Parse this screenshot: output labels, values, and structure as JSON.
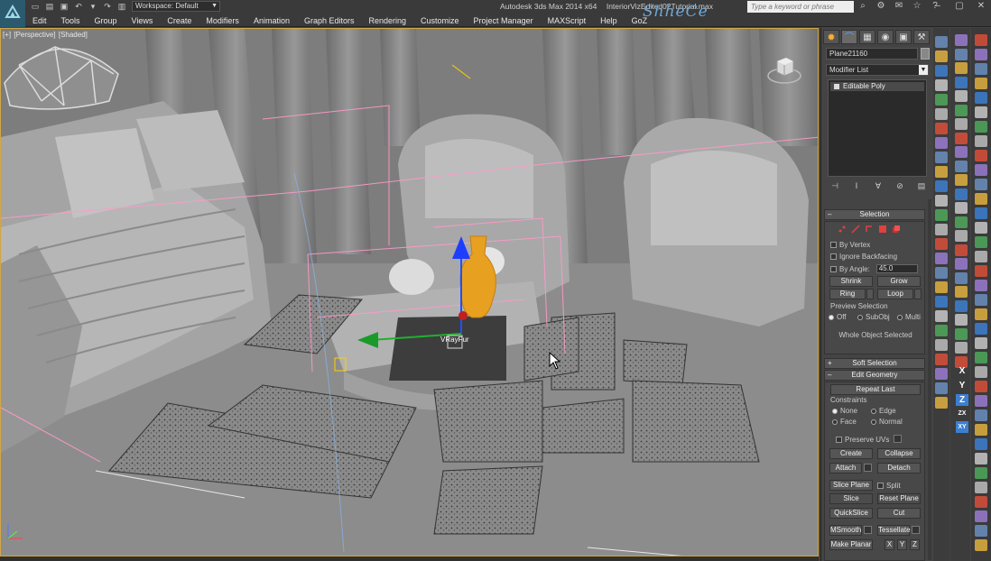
{
  "titlebar": {
    "workspace": "Workspace: Default",
    "app_name": "Autodesk 3ds Max  2014 x64",
    "file_name": "InteriorVizEdited02Tutorial.max",
    "watermark": "ShheCe",
    "search_placeholder": "Type a keyword or phrase"
  },
  "menu": [
    "Edit",
    "Tools",
    "Group",
    "Views",
    "Create",
    "Modifiers",
    "Animation",
    "Graph Editors",
    "Rendering",
    "Customize",
    "Project Manager",
    "MAXScript",
    "Help",
    "GoZ"
  ],
  "viewport": {
    "label_plus": "[+]",
    "label_view": "[Perspective]",
    "label_shading": "[Shaded]",
    "object_label": "VRayFur",
    "colors": {
      "border": "#d1a646",
      "scene": "#7a7a7a",
      "wire": "#ff9ac8"
    }
  },
  "command_panel": {
    "object_name": "Plane21160",
    "modifier_list": "Modifier List",
    "stack_item": "Editable Poly",
    "selection": {
      "title": "Selection",
      "by_vertex": "By Vertex",
      "ignore_backfacing": "Ignore Backfacing",
      "by_angle": "By Angle:",
      "angle_value": "45.0",
      "shrink": "Shrink",
      "grow": "Grow",
      "ring": "Ring",
      "loop": "Loop",
      "preview_selection": "Preview Selection",
      "preview_off": "Off",
      "preview_subobj": "SubObj",
      "preview_multi": "Multi",
      "status": "Whole Object Selected"
    },
    "soft_selection": {
      "title": "Soft Selection"
    },
    "edit_geometry": {
      "title": "Edit Geometry",
      "repeat_last": "Repeat Last",
      "constraints": "Constraints",
      "none": "None",
      "edge": "Edge",
      "face": "Face",
      "normal": "Normal",
      "preserve_uvs": "Preserve UVs",
      "create": "Create",
      "collapse": "Collapse",
      "attach": "Attach",
      "detach": "Detach",
      "slice_plane": "Slice Plane",
      "split": "Split",
      "slice": "Slice",
      "reset_plane": "Reset Plane",
      "quickslice": "QuickSlice",
      "cut": "Cut",
      "msmooth": "MSmooth",
      "tessellate": "Tessellate",
      "make_planar": "Make Planar",
      "x": "X",
      "y": "Y",
      "z": "Z"
    }
  },
  "axis_toolbar": {
    "x": "X",
    "y": "Y",
    "z": "Z",
    "xy": "XY",
    "zx": "ZX"
  }
}
